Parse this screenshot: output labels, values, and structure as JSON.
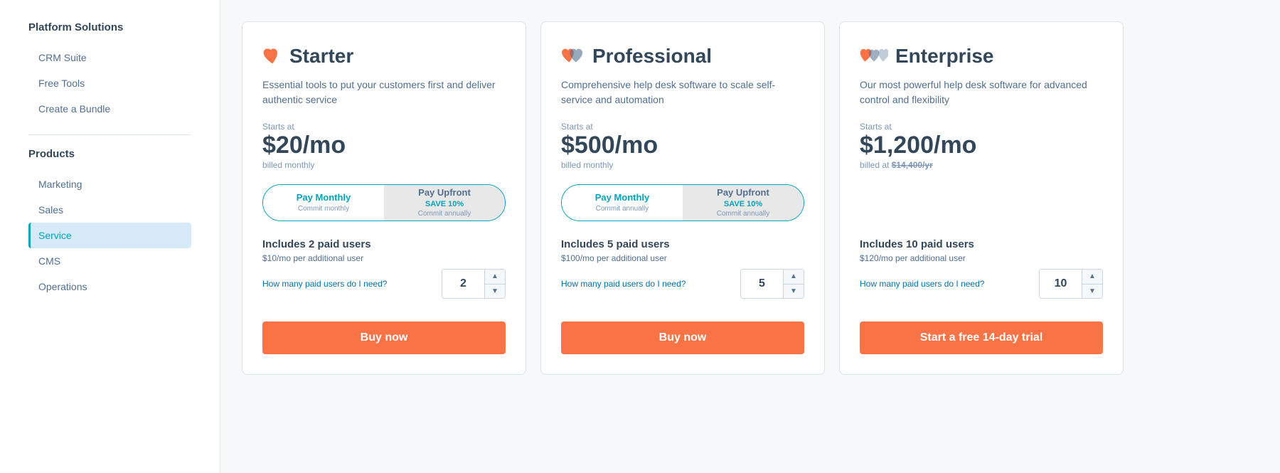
{
  "sidebar": {
    "platform_title": "Platform Solutions",
    "platform_items": [
      {
        "label": "CRM Suite",
        "active": false
      },
      {
        "label": "Free Tools",
        "active": false
      },
      {
        "label": "Create a Bundle",
        "active": false
      }
    ],
    "products_title": "Products",
    "products_items": [
      {
        "label": "Marketing",
        "active": false
      },
      {
        "label": "Sales",
        "active": false
      },
      {
        "label": "Service",
        "active": true
      },
      {
        "label": "CMS",
        "active": false
      },
      {
        "label": "Operations",
        "active": false
      }
    ]
  },
  "cards": [
    {
      "id": "starter",
      "title": "Starter",
      "description": "Essential tools to put your customers first and deliver authentic service",
      "starts_at": "Starts at",
      "price": "$20/mo",
      "price_sub": "billed monthly",
      "price_sub_strikethrough": null,
      "toggle_left_label": "Pay Monthly",
      "toggle_left_sub": "Commit monthly",
      "toggle_right_label": "Pay Upfront",
      "toggle_right_save": "SAVE 10%",
      "toggle_right_sub": "Commit annually",
      "toggle_active": "left",
      "users_title": "Includes 2 paid users",
      "users_additional": "$10/mo per additional user",
      "users_link": "How many paid users do I need?",
      "users_value": "2",
      "buy_label": "Buy now"
    },
    {
      "id": "professional",
      "title": "Professional",
      "description": "Comprehensive help desk software to scale self-service and automation",
      "starts_at": "Starts at",
      "price": "$500/mo",
      "price_sub": "billed monthly",
      "price_sub_strikethrough": null,
      "toggle_left_label": "Pay Monthly",
      "toggle_left_sub": "Commit annually",
      "toggle_right_label": "Pay Upfront",
      "toggle_right_save": "SAVE 10%",
      "toggle_right_sub": "Commit annually",
      "toggle_active": "left",
      "users_title": "Includes 5 paid users",
      "users_additional": "$100/mo per additional user",
      "users_link": "How many paid users do I need?",
      "users_value": "5",
      "buy_label": "Buy now"
    },
    {
      "id": "enterprise",
      "title": "Enterprise",
      "description": "Our most powerful help desk software for advanced control and flexibility",
      "starts_at": "Starts at",
      "price": "$1,200/mo",
      "price_sub": "billed at $14,400/yr",
      "price_sub_strikethrough": "$14,400/yr",
      "toggle_left_label": null,
      "toggle_active": "none",
      "users_title": "Includes 10 paid users",
      "users_additional": "$120/mo per additional user",
      "users_link": "How many paid users do I need?",
      "users_value": "10",
      "buy_label": "Start a free 14-day trial"
    }
  ],
  "icons": {
    "chevron_up": "▲",
    "chevron_down": "▼"
  }
}
